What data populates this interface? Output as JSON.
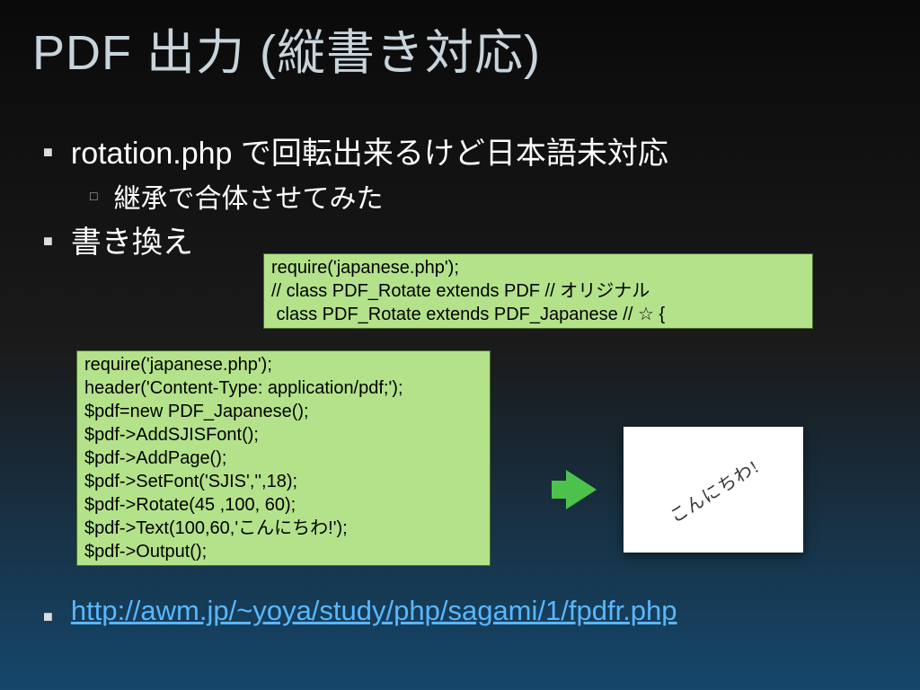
{
  "title": "PDF 出力 (縦書き対応)",
  "bullets": {
    "b1": "rotation.php で回転出来るけど日本語未対応",
    "b1_sub": "継承で合体させてみた",
    "b2": "書き換え"
  },
  "code1": "require('japanese.php');\n// class PDF_Rotate extends PDF // オリジナル\n class PDF_Rotate extends PDF_Japanese // ☆ {",
  "code2": "require('japanese.php');\nheader('Content-Type: application/pdf;');\n$pdf=new PDF_Japanese();\n$pdf->AddSJISFont();\n$pdf->AddPage();\n$pdf->SetFont('SJIS','',18);\n$pdf->Rotate(45 ,100, 60);\n$pdf->Text(100,60,'こんにちわ!');\n$pdf->Output();",
  "rotated_text": "こんにちわ!",
  "link": "http://awm.jp/~yoya/study/php/sagami/1/fpdfr.php",
  "colors": {
    "codebox_bg": "#b4e28a",
    "codebox_border": "#486a2c",
    "link": "#59b7ff",
    "arrow": "#4cc24c",
    "title": "#c8d4dc"
  }
}
